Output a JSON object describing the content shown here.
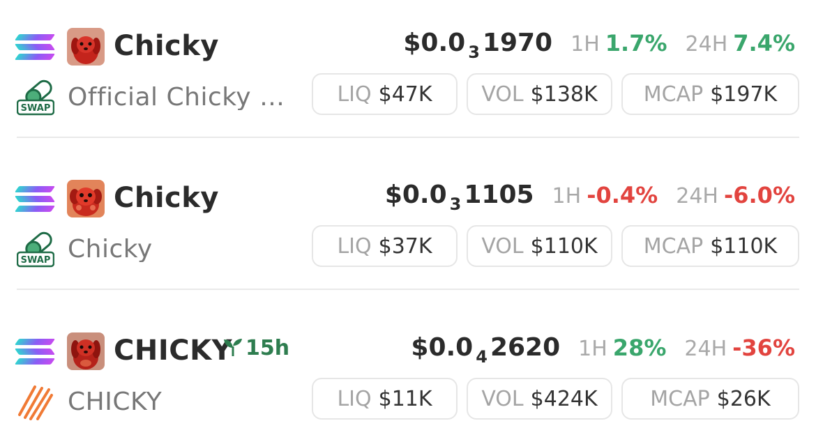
{
  "rows": [
    {
      "name": "Chicky",
      "age": "",
      "pair": "Official Chicky C...",
      "price_prefix": "$0.0",
      "price_sub": "3",
      "price_digits": "1970",
      "h1_label": "1H",
      "h1_value": "1.7%",
      "h1_dir": "up",
      "h24_label": "24H",
      "h24_value": "7.4%",
      "h24_dir": "up",
      "liq_label": "LIQ",
      "liq_value": "$47K",
      "vol_label": "VOL",
      "vol_value": "$138K",
      "mcap_label": "MCAP",
      "mcap_value": "$197K",
      "chain_icon": "solana-icon",
      "dex_icon": "swap-pill-icon",
      "dex_label": "SWAP"
    },
    {
      "name": "Chicky",
      "age": "",
      "pair": "Chicky",
      "price_prefix": "$0.0",
      "price_sub": "3",
      "price_digits": "1105",
      "h1_label": "1H",
      "h1_value": "-0.4%",
      "h1_dir": "down",
      "h24_label": "24H",
      "h24_value": "-6.0%",
      "h24_dir": "down",
      "liq_label": "LIQ",
      "liq_value": "$37K",
      "vol_label": "VOL",
      "vol_value": "$110K",
      "mcap_label": "MCAP",
      "mcap_value": "$110K",
      "chain_icon": "solana-icon",
      "dex_icon": "swap-pill-icon",
      "dex_label": "SWAP"
    },
    {
      "name": "CHICKY",
      "age": "15h",
      "pair": "CHICKY",
      "price_prefix": "$0.0",
      "price_sub": "4",
      "price_digits": "2620",
      "h1_label": "1H",
      "h1_value": "28%",
      "h1_dir": "up",
      "h24_label": "24H",
      "h24_value": "-36%",
      "h24_dir": "down",
      "liq_label": "LIQ",
      "liq_value": "$11K",
      "vol_label": "VOL",
      "vol_value": "$424K",
      "mcap_label": "MCAP",
      "mcap_value": "$26K",
      "chain_icon": "solana-icon",
      "dex_icon": "pumpfun-stripes-icon",
      "age_icon": "sprout-icon"
    }
  ],
  "colors": {
    "positive": "#3aa66c",
    "negative": "#e2443f",
    "age": "#2e7d4f",
    "muted": "#a4a4a4"
  }
}
